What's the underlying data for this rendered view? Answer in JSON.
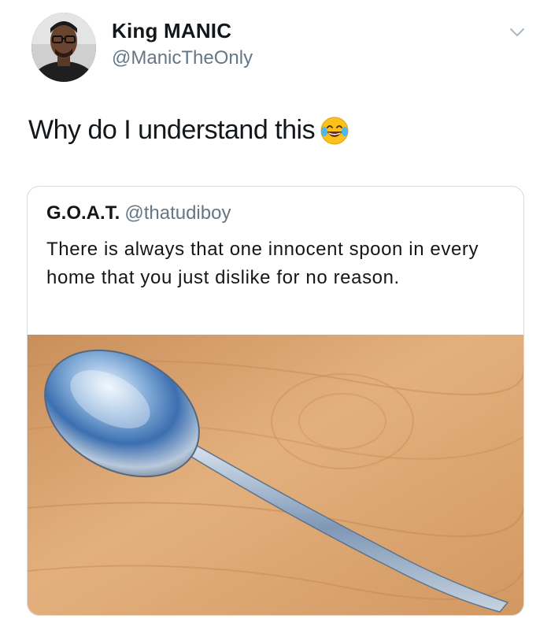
{
  "tweet": {
    "display_name": "King MANIC",
    "username": "@ManicTheOnly",
    "text": "Why do I understand this",
    "emoji_icon": "face-with-tears-of-joy-icon",
    "menu_icon": "chevron-down-icon"
  },
  "quote": {
    "display_name": "G.O.A.T.",
    "username": "@thatudiboy",
    "text": "There is always that one innocent spoon in every home that you just dislike for no reason.",
    "media_icon": "spoon-photo"
  },
  "colors": {
    "text_primary": "#14171a",
    "text_secondary": "#657786",
    "border": "#d6dbe0",
    "wood": "#d9a36e"
  }
}
